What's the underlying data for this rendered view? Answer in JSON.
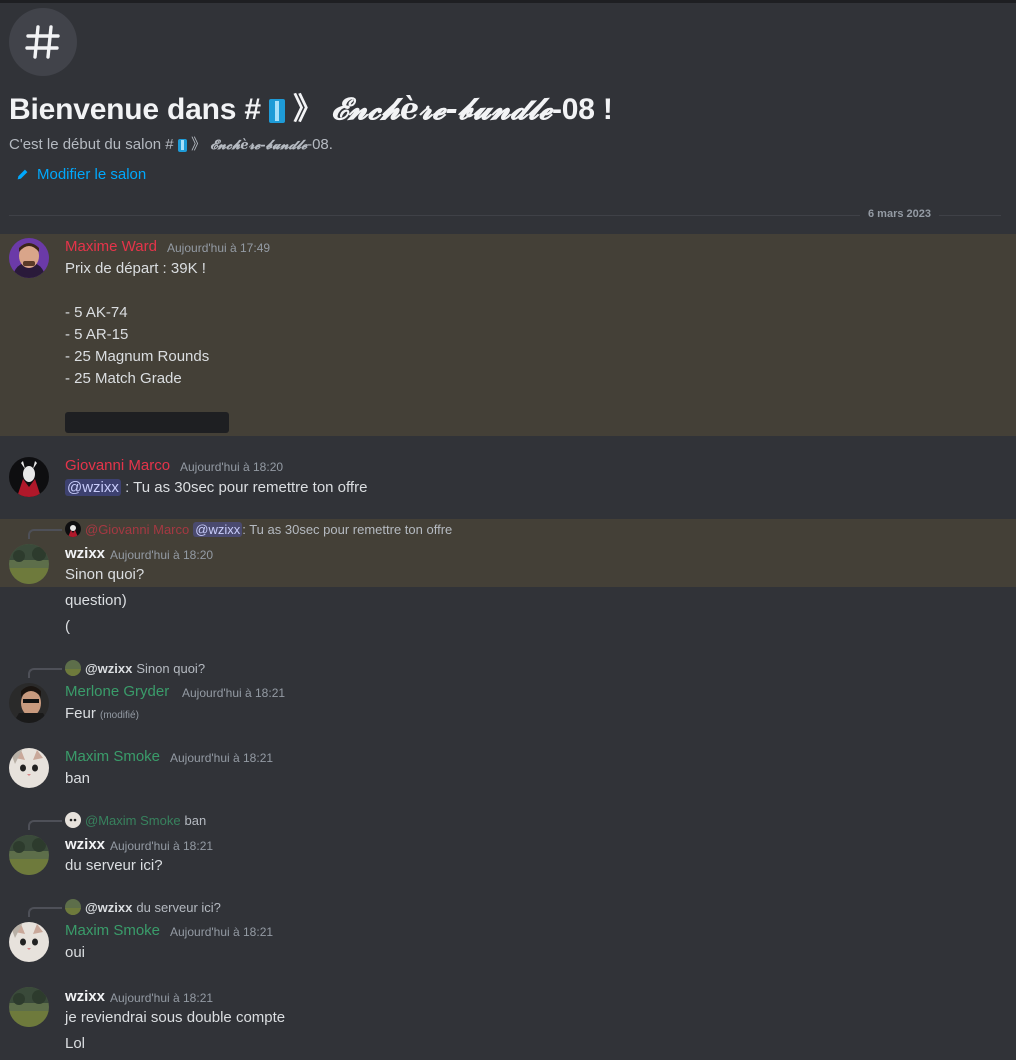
{
  "channel": {
    "hash_symbol": "#",
    "welcome_prefix": "Bienvenue dans # ",
    "arrows": "》",
    "fancy_name": "𝓔𝓷𝓬𝓱è𝓻𝓮-𝓫𝓾𝓷𝓭𝓵𝓮",
    "suffix": "-08 !",
    "sub_prefix": "C'est le début du salon # ",
    "sub_suffix": "-08.",
    "edit_label": "Modifier le salon",
    "date_divider": "6 mars 2023"
  },
  "colors": {
    "role_red": "#e5344a",
    "role_green": "#3a9c6a",
    "highlight": "#444037",
    "link": "#00a8fc"
  },
  "messages": [
    {
      "author": "Maxime Ward",
      "timestamp": "Aujourd'hui à 17:49",
      "lines": [
        "Prix de départ : 39K !",
        "- 5 AK-74",
        "- 5 AR-15",
        "- 25 Magnum Rounds",
        "- 25 Match Grade"
      ]
    },
    {
      "author": "Giovanni Marco",
      "timestamp": "Aujourd'hui à 18:20",
      "mention": "@wzixx",
      "text": " : Tu as 30sec pour remettre ton offre"
    },
    {
      "reply_author": "@Giovanni Marco",
      "reply_mention": "@wzixx",
      "reply_text": " : Tu as 30sec pour remettre ton offre",
      "author": "wzixx",
      "timestamp": "Aujourd'hui à 18:20",
      "lines": [
        "Sinon quoi?",
        "question)",
        "("
      ]
    },
    {
      "reply_author": "@wzixx",
      "reply_text": "Sinon quoi?",
      "author": "Merlone Gryder",
      "timestamp": "Aujourd'hui à 18:21",
      "text": "Feur",
      "edited": "(modifié)"
    },
    {
      "author": "Maxim Smoke",
      "timestamp": "Aujourd'hui à 18:21",
      "text": "ban"
    },
    {
      "reply_author": "@Maxim Smoke",
      "reply_text": "ban",
      "author": "wzixx",
      "timestamp": "Aujourd'hui à 18:21",
      "text": "du serveur ici?"
    },
    {
      "reply_author": "@wzixx",
      "reply_text": "du serveur ici?",
      "author": "Maxim Smoke",
      "timestamp": "Aujourd'hui à 18:21",
      "text": "oui"
    },
    {
      "author": "wzixx",
      "timestamp": "Aujourd'hui à 18:21",
      "lines": [
        "je reviendrai sous double compte",
        "Lol"
      ]
    }
  ]
}
